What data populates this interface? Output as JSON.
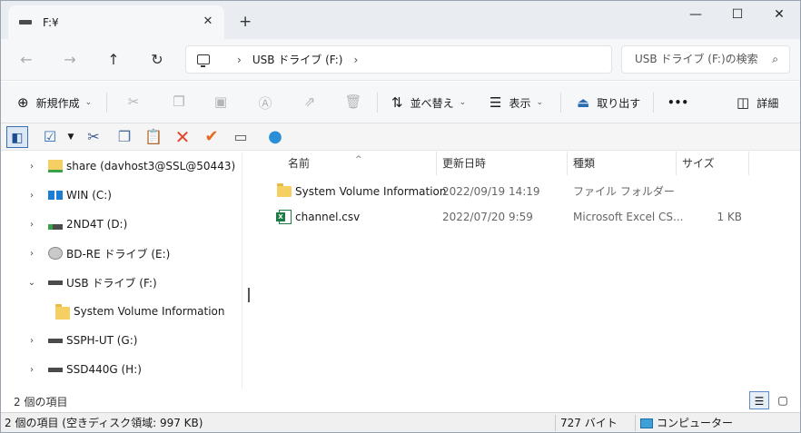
{
  "tab": {
    "title": "F:¥",
    "close": "✕",
    "new_tab": "+"
  },
  "window_controls": {
    "minimize": "—",
    "maximize": "☐",
    "close": "✕"
  },
  "address": {
    "segment": "USB ドライブ (F:)",
    "separator_left": "›",
    "separator_right": "›"
  },
  "search": {
    "placeholder": "USB ドライブ (F:)の検索"
  },
  "commands": {
    "new": "新規作成",
    "sort": "並べ替え",
    "view": "表示",
    "eject": "取り出す",
    "more": "•••",
    "details": "詳細"
  },
  "nav_tree": [
    {
      "label": "share (davhost3@SSL@50443)",
      "expand": "›",
      "icon": "network-folder"
    },
    {
      "label": "WIN (C:)",
      "expand": "›",
      "icon": "windows-drive"
    },
    {
      "label": "2ND4T (D:)",
      "expand": "›",
      "icon": "drive"
    },
    {
      "label": "BD-RE ドライブ (E:)",
      "expand": "›",
      "icon": "optical-drive"
    },
    {
      "label": "USB ドライブ (F:)",
      "expand": "⌄",
      "icon": "usb-drive"
    },
    {
      "label": "System Volume Information",
      "expand": "",
      "icon": "folder"
    },
    {
      "label": "SSPH-UT (G:)",
      "expand": "›",
      "icon": "drive"
    },
    {
      "label": "SSD440G (H:)",
      "expand": "›",
      "icon": "drive"
    }
  ],
  "columns": {
    "name": "名前",
    "modified": "更新日時",
    "type": "種類",
    "size": "サイズ"
  },
  "files": [
    {
      "name": "System Volume Information",
      "modified": "2022/09/19 14:19",
      "type": "ファイル フォルダー",
      "size": "",
      "icon": "folder"
    },
    {
      "name": "channel.csv",
      "modified": "2022/07/20 9:59",
      "type": "Microsoft Excel CS...",
      "size": "1 KB",
      "icon": "excel-csv"
    }
  ],
  "item_count": "2 個の項目",
  "status": {
    "left": "2 個の項目 (空きディスク領域: 997 KB)",
    "size": "727 バイト",
    "location": "コンピューター"
  }
}
